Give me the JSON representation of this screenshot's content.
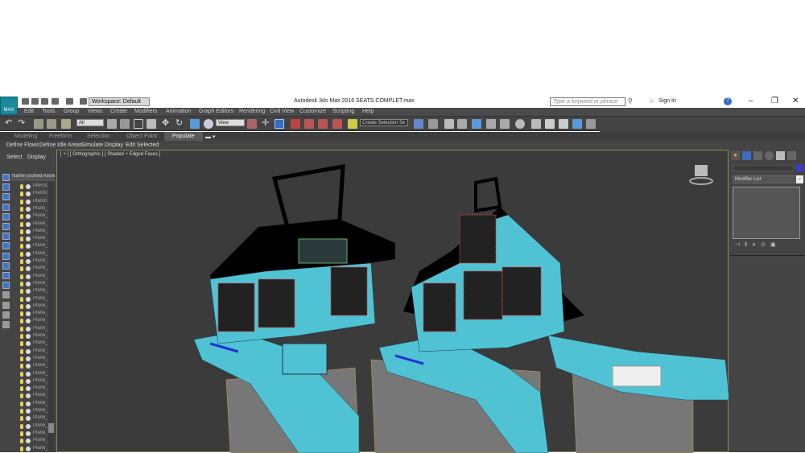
{
  "title": {
    "app_badge": "MAX",
    "workspace": "Workspace: Default",
    "text": "Autodesk 3ds Max 2016    SEATS COMPLET.max",
    "search_placeholder": "Type a keyword or phrase",
    "sign_in": "Sign In",
    "minimize": "–",
    "restore": "❐",
    "close": "✕"
  },
  "menu": [
    "Edit",
    "Tools",
    "Group",
    "Views",
    "Create",
    "Modifiers",
    "Animation",
    "Graph Editors",
    "Rendering",
    "Civil View",
    "Customize",
    "Scripting",
    "Help"
  ],
  "toolbar": {
    "filter": "All",
    "coord": "View",
    "selection_set": "Create Selection Se"
  },
  "ribbon": {
    "tabs": [
      "Modeling",
      "Freeform",
      "Selection",
      "Object Paint",
      "Populate"
    ],
    "active_tab": "Populate",
    "panel_items": [
      "Define Flows",
      "Define Idle Areas",
      "Simulate",
      "Display",
      "Edit Selected"
    ]
  },
  "scene_explorer": {
    "tabs": [
      "Select",
      "Display"
    ],
    "column_header": "Name (Sorted Ascending)",
    "items": [
      "PARSO",
      "Plan00",
      "Plan00",
      "Plane_",
      "Plane_",
      "Plane_",
      "Plane_",
      "Plane_",
      "Plane_",
      "Plane_",
      "Plane_",
      "Plane_",
      "Plane_",
      "Plane_",
      "Plane_",
      "Plane_",
      "Plane_",
      "Plane_",
      "Plane_",
      "Plane_",
      "Plane_",
      "Plane_",
      "Plane_",
      "Plane_",
      "Plane_",
      "Plane_",
      "Plane_",
      "Plane_",
      "Plane_",
      "Plane_",
      "Plane_",
      "Plane_",
      "Plane_",
      "Plane_",
      "Plane_",
      "Plane_"
    ]
  },
  "viewport": {
    "label": "[ + ] [ Orthographic ] [ Shaded + Edged Faces ]"
  },
  "command_panel": {
    "modifier_list": "Modifier List",
    "object_color": "#3a3ad0"
  },
  "colors": {
    "accent": "#1a8a9a",
    "mesh_cyan": "#4fc3d4"
  }
}
